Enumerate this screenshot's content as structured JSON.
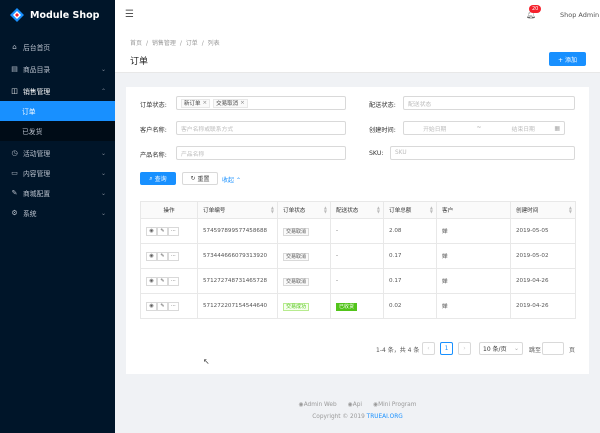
{
  "brand": {
    "name": "Module Shop"
  },
  "sidebar": {
    "items": [
      {
        "label": "后台首页",
        "icon": "home-icon",
        "glyph": "⌂"
      },
      {
        "label": "商品目录",
        "icon": "shop-icon",
        "glyph": "▤"
      },
      {
        "label": "销售管理",
        "icon": "cart-icon",
        "glyph": "◫"
      },
      {
        "label": "活动管理",
        "icon": "activity-icon",
        "glyph": "◷"
      },
      {
        "label": "内容管理",
        "icon": "file-icon",
        "glyph": "▭"
      },
      {
        "label": "商城配置",
        "icon": "tool-icon",
        "glyph": "✎"
      },
      {
        "label": "系统",
        "icon": "setting-icon",
        "glyph": "⚙"
      }
    ],
    "sub_items": [
      {
        "label": "订单"
      },
      {
        "label": "已发货"
      }
    ]
  },
  "topbar": {
    "badge": "20",
    "user": "Shop Admin"
  },
  "breadcrumb": [
    "首页",
    "/",
    "销售管理",
    "/",
    "订单",
    "/",
    "列表"
  ],
  "page": {
    "title": "订单",
    "add_label": "+ 添加"
  },
  "filters": {
    "order_status_label": "订单状态:",
    "order_status_tags": [
      "新订单",
      "交易取消"
    ],
    "ship_status_label": "配送状态:",
    "ship_status_placeholder": "配送状态",
    "customer_label": "客户名称:",
    "customer_placeholder": "客户名称或联系方式",
    "created_label": "创建时间:",
    "start_placeholder": "开始日期",
    "range_sep": "~",
    "end_placeholder": "结束日期",
    "product_label": "产品名称:",
    "product_placeholder": "产品名称",
    "sku_label": "SKU:",
    "sku_placeholder": "SKU",
    "search_label": "查询",
    "reset_label": "重置",
    "collapse_label": "收起"
  },
  "table": {
    "columns": [
      "操作",
      "订单编号",
      "订单状态",
      "配送状态",
      "订单总额",
      "客户",
      "创建时间"
    ],
    "rows": [
      {
        "id": "574597899577458688",
        "status": "交易取消",
        "status_style": "",
        "ship": "-",
        "ship_style": "",
        "total": "2.08",
        "customer": "婵",
        "created": "2019-05-05"
      },
      {
        "id": "573444666079313920",
        "status": "交易取消",
        "status_style": "",
        "ship": "-",
        "ship_style": "",
        "total": "0.17",
        "customer": "婵",
        "created": "2019-05-02"
      },
      {
        "id": "571272748731465728",
        "status": "交易取消",
        "status_style": "",
        "ship": "-",
        "ship_style": "",
        "total": "0.17",
        "customer": "婵",
        "created": "2019-04-26"
      },
      {
        "id": "571272207154544640",
        "status": "交易成功",
        "status_style": "ok",
        "ship": "已收货",
        "ship_style": "go",
        "total": "0.02",
        "customer": "婵",
        "created": "2019-04-26"
      }
    ]
  },
  "pagination": {
    "summary": "1-4 条，共 4 条",
    "page": "1",
    "page_size": "10 条/页",
    "jump_label": "跳至",
    "jump_suffix": "页"
  },
  "footer": {
    "links": [
      "Admin Web",
      "Api",
      "Mini Program"
    ],
    "copyright": "Copyright © 2019",
    "org": "TRUEAI.ORG"
  }
}
